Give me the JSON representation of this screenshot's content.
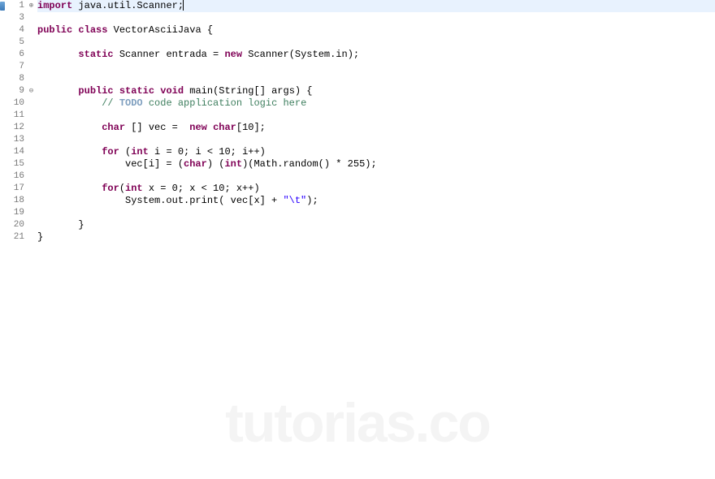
{
  "watermark": "tutorias.co",
  "lines": [
    {
      "n": 1,
      "highlight": true,
      "leftmark": true,
      "fold": "plus",
      "tokens": [
        [
          "kw",
          "import"
        ],
        [
          "plain",
          " java.util.Scanner;"
        ]
      ],
      "cursor": true
    },
    {
      "n": 3,
      "highlight": false,
      "leftmark": false,
      "fold": "",
      "tokens": []
    },
    {
      "n": 4,
      "highlight": false,
      "leftmark": false,
      "fold": "",
      "tokens": [
        [
          "kw",
          "public"
        ],
        [
          "plain",
          " "
        ],
        [
          "kw",
          "class"
        ],
        [
          "plain",
          " VectorAsciiJava {"
        ]
      ]
    },
    {
      "n": 5,
      "highlight": false,
      "leftmark": false,
      "fold": "",
      "tokens": []
    },
    {
      "n": 6,
      "highlight": false,
      "leftmark": false,
      "fold": "",
      "tokens": [
        [
          "plain",
          "       "
        ],
        [
          "kw",
          "static"
        ],
        [
          "plain",
          " Scanner entrada = "
        ],
        [
          "kw",
          "new"
        ],
        [
          "plain",
          " Scanner(System.in);"
        ]
      ]
    },
    {
      "n": 7,
      "highlight": false,
      "leftmark": false,
      "fold": "",
      "tokens": []
    },
    {
      "n": 8,
      "highlight": false,
      "leftmark": false,
      "fold": "",
      "tokens": []
    },
    {
      "n": 9,
      "highlight": false,
      "leftmark": false,
      "fold": "minus",
      "tokens": [
        [
          "plain",
          "       "
        ],
        [
          "kw",
          "public"
        ],
        [
          "plain",
          " "
        ],
        [
          "kw",
          "static"
        ],
        [
          "plain",
          " "
        ],
        [
          "kw",
          "void"
        ],
        [
          "plain",
          " main(String[] args) {"
        ]
      ]
    },
    {
      "n": 10,
      "highlight": false,
      "leftmark": false,
      "fold": "",
      "tokens": [
        [
          "plain",
          "           "
        ],
        [
          "com",
          "// "
        ],
        [
          "todo",
          "TODO"
        ],
        [
          "com",
          " code application logic here"
        ]
      ]
    },
    {
      "n": 11,
      "highlight": false,
      "leftmark": false,
      "fold": "",
      "tokens": []
    },
    {
      "n": 12,
      "highlight": false,
      "leftmark": false,
      "fold": "",
      "tokens": [
        [
          "plain",
          "           "
        ],
        [
          "kw",
          "char"
        ],
        [
          "plain",
          " [] vec =  "
        ],
        [
          "kw",
          "new"
        ],
        [
          "plain",
          " "
        ],
        [
          "kw",
          "char"
        ],
        [
          "plain",
          "[10];"
        ]
      ]
    },
    {
      "n": 13,
      "highlight": false,
      "leftmark": false,
      "fold": "",
      "tokens": []
    },
    {
      "n": 14,
      "highlight": false,
      "leftmark": false,
      "fold": "",
      "tokens": [
        [
          "plain",
          "           "
        ],
        [
          "kw",
          "for"
        ],
        [
          "plain",
          " ("
        ],
        [
          "kw",
          "int"
        ],
        [
          "plain",
          " i = 0; i < 10; i++)"
        ]
      ]
    },
    {
      "n": 15,
      "highlight": false,
      "leftmark": false,
      "fold": "",
      "tokens": [
        [
          "plain",
          "               vec[i] = ("
        ],
        [
          "kw",
          "char"
        ],
        [
          "plain",
          ") ("
        ],
        [
          "kw",
          "int"
        ],
        [
          "plain",
          ")(Math.random() * 255);"
        ]
      ]
    },
    {
      "n": 16,
      "highlight": false,
      "leftmark": false,
      "fold": "",
      "tokens": []
    },
    {
      "n": 17,
      "highlight": false,
      "leftmark": false,
      "fold": "",
      "tokens": [
        [
          "plain",
          "           "
        ],
        [
          "kw",
          "for"
        ],
        [
          "plain",
          "("
        ],
        [
          "kw",
          "int"
        ],
        [
          "plain",
          " x = 0; x < 10; x++)"
        ]
      ]
    },
    {
      "n": 18,
      "highlight": false,
      "leftmark": false,
      "fold": "",
      "tokens": [
        [
          "plain",
          "               System.out.print( vec[x] + "
        ],
        [
          "str",
          "\"\\t\""
        ],
        [
          "plain",
          ");"
        ]
      ]
    },
    {
      "n": 19,
      "highlight": false,
      "leftmark": false,
      "fold": "",
      "tokens": []
    },
    {
      "n": 20,
      "highlight": false,
      "leftmark": false,
      "fold": "",
      "tokens": [
        [
          "plain",
          "       }"
        ]
      ]
    },
    {
      "n": 21,
      "highlight": false,
      "leftmark": false,
      "fold": "",
      "tokens": [
        [
          "plain",
          "}"
        ]
      ]
    }
  ]
}
